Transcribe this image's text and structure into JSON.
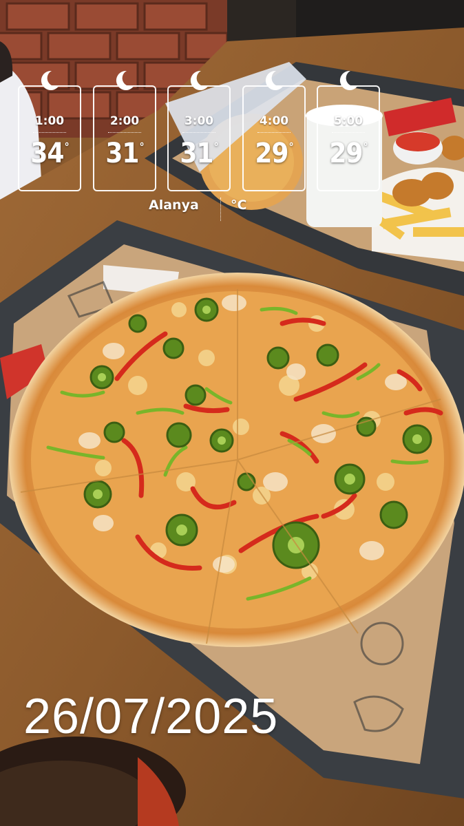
{
  "weather": {
    "hours": [
      {
        "time": "1:00",
        "temp": "34",
        "icon": "crescent-moon-icon"
      },
      {
        "time": "2:00",
        "temp": "31",
        "icon": "crescent-moon-icon"
      },
      {
        "time": "3:00",
        "temp": "31",
        "icon": "crescent-moon-icon"
      },
      {
        "time": "4:00",
        "temp": "29",
        "icon": "crescent-moon-icon"
      },
      {
        "time": "5:00",
        "temp": "29",
        "icon": "crescent-moon-icon"
      }
    ],
    "degree_symbol": "°",
    "city": "Alanya",
    "unit": "°C"
  },
  "date_stamp": "26/07/2025",
  "colors": {
    "overlay_text": "#ffffff",
    "table_wood": "#8a5a2e",
    "tray": "#3b3f44",
    "pizza_crust": "#e9b46a"
  }
}
